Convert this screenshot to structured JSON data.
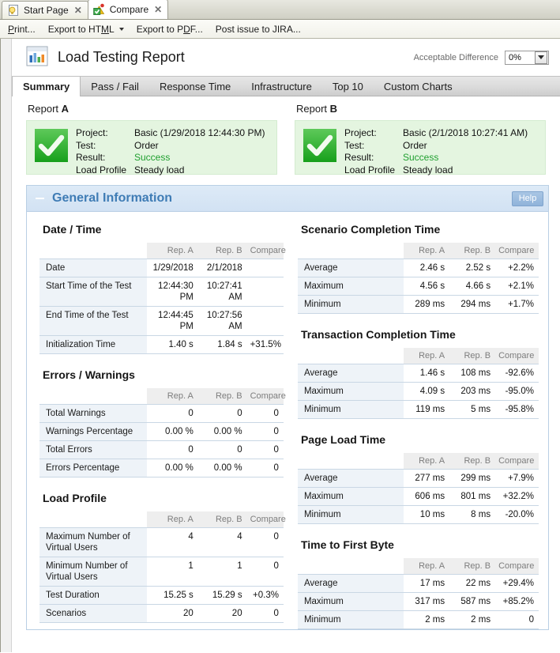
{
  "window": {
    "tabs": [
      {
        "label": "Start Page",
        "icon": "lightbulb-icon",
        "active": false,
        "close": "✕"
      },
      {
        "label": "Compare",
        "icon": "compare-icon",
        "active": true,
        "close": "✕"
      }
    ]
  },
  "command_bar": {
    "items": [
      {
        "label": "Print...",
        "name": "print-command",
        "mnemonic": "P",
        "split": false
      },
      {
        "label": "Export to HTML",
        "name": "export-html-command",
        "mnemonic": "M",
        "split": true
      },
      {
        "label": "Export to PDF...",
        "name": "export-pdf-command",
        "mnemonic": "D",
        "split": false
      },
      {
        "label": "Post issue to JIRA...",
        "name": "post-jira-command",
        "mnemonic": "",
        "split": false
      }
    ]
  },
  "report": {
    "title": "Load Testing Report",
    "acceptable_difference_label": "Acceptable Difference",
    "acceptable_difference_value": "0%"
  },
  "subtabs": [
    {
      "label": "Summary",
      "active": true
    },
    {
      "label": "Pass / Fail",
      "active": false
    },
    {
      "label": "Response Time",
      "active": false
    },
    {
      "label": "Infrastructure",
      "active": false
    },
    {
      "label": "Top 10",
      "active": false
    },
    {
      "label": "Custom Charts",
      "active": false
    }
  ],
  "cards": [
    {
      "caption_prefix": "Report ",
      "caption_letter": "A",
      "rows": [
        {
          "key": "Project:",
          "value": "Basic (1/29/2018 12:44:30 PM)",
          "state": ""
        },
        {
          "key": "Test:",
          "value": "Order",
          "state": ""
        },
        {
          "key": "Result:",
          "value": "Success",
          "state": "ok"
        },
        {
          "key": "Load Profile",
          "value": "Steady load",
          "state": ""
        }
      ]
    },
    {
      "caption_prefix": "Report ",
      "caption_letter": "B",
      "rows": [
        {
          "key": "Project:",
          "value": "Basic (2/1/2018 10:27:41 AM)",
          "state": ""
        },
        {
          "key": "Test:",
          "value": "Order",
          "state": ""
        },
        {
          "key": "Result:",
          "value": "Success",
          "state": "ok"
        },
        {
          "key": "Load Profile",
          "value": "Steady load",
          "state": ""
        }
      ]
    }
  ],
  "panel": {
    "title": "General Information",
    "help_label": "Help",
    "collapsed": false
  },
  "columns": {
    "headers": [
      "",
      "Rep. A",
      "Rep. B",
      "Compare"
    ],
    "left": [
      {
        "title": "Date / Time",
        "rows": [
          {
            "label": "Date",
            "a": "1/29/2018",
            "b": "2/1/2018",
            "compare": "",
            "compare_state": ""
          },
          {
            "label": "Start Time of the Test",
            "a": "12:44:30 PM",
            "b": "10:27:41 AM",
            "compare": "",
            "compare_state": ""
          },
          {
            "label": "End Time of the Test",
            "a": "12:44:45 PM",
            "b": "10:27:56 AM",
            "compare": "",
            "compare_state": ""
          },
          {
            "label": "Initialization Time",
            "a": "1.40 s",
            "b": "1.84 s",
            "compare": "+31.5%",
            "compare_state": "pos"
          }
        ]
      },
      {
        "title": "Errors / Warnings",
        "rows": [
          {
            "label": "Total Warnings",
            "a": "0",
            "b": "0",
            "compare": "0",
            "compare_state": "zero"
          },
          {
            "label": "Warnings Percentage",
            "a": "0.00 %",
            "b": "0.00 %",
            "compare": "0",
            "compare_state": "zero"
          },
          {
            "label": "Total Errors",
            "a": "0",
            "b": "0",
            "compare": "0",
            "compare_state": "zero"
          },
          {
            "label": "Errors Percentage",
            "a": "0.00 %",
            "b": "0.00 %",
            "compare": "0",
            "compare_state": "zero"
          }
        ]
      },
      {
        "title": "Load Profile",
        "rows": [
          {
            "label": "Maximum Number of Virtual Users",
            "a": "4",
            "b": "4",
            "compare": "0",
            "compare_state": "zero"
          },
          {
            "label": "Minimum Number of Virtual Users",
            "a": "1",
            "b": "1",
            "compare": "0",
            "compare_state": "zero"
          },
          {
            "label": "Test Duration",
            "a": "15.25 s",
            "b": "15.29 s",
            "compare": "+0.3%",
            "compare_state": "pos"
          },
          {
            "label": "Scenarios",
            "a": "20",
            "b": "20",
            "compare": "0",
            "compare_state": "zero"
          }
        ]
      }
    ],
    "right": [
      {
        "title": "Scenario Completion Time",
        "rows": [
          {
            "label": "Average",
            "a": "2.46 s",
            "b": "2.52 s",
            "compare": "+2.2%",
            "compare_state": "pos"
          },
          {
            "label": "Maximum",
            "a": "4.56 s",
            "b": "4.66 s",
            "compare": "+2.1%",
            "compare_state": "pos"
          },
          {
            "label": "Minimum",
            "a": "289 ms",
            "b": "294 ms",
            "compare": "+1.7%",
            "compare_state": "pos"
          }
        ]
      },
      {
        "title": "Transaction Completion Time",
        "rows": [
          {
            "label": "Average",
            "a": "1.46 s",
            "b": "108 ms",
            "compare": "-92.6%",
            "compare_state": "neg"
          },
          {
            "label": "Maximum",
            "a": "4.09 s",
            "b": "203 ms",
            "compare": "-95.0%",
            "compare_state": "neg"
          },
          {
            "label": "Minimum",
            "a": "119 ms",
            "b": "5 ms",
            "compare": "-95.8%",
            "compare_state": "neg"
          }
        ]
      },
      {
        "title": "Page Load Time",
        "rows": [
          {
            "label": "Average",
            "a": "277 ms",
            "b": "299 ms",
            "compare": "+7.9%",
            "compare_state": "pos"
          },
          {
            "label": "Maximum",
            "a": "606 ms",
            "b": "801 ms",
            "compare": "+32.2%",
            "compare_state": "pos"
          },
          {
            "label": "Minimum",
            "a": "10 ms",
            "b": "8 ms",
            "compare": "-20.0%",
            "compare_state": "neg"
          }
        ]
      },
      {
        "title": "Time to First Byte",
        "rows": [
          {
            "label": "Average",
            "a": "17 ms",
            "b": "22 ms",
            "compare": "+29.4%",
            "compare_state": "pos"
          },
          {
            "label": "Maximum",
            "a": "317 ms",
            "b": "587 ms",
            "compare": "+85.2%",
            "compare_state": "pos"
          },
          {
            "label": "Minimum",
            "a": "2 ms",
            "b": "2 ms",
            "compare": "0",
            "compare_state": "zero"
          }
        ]
      }
    ]
  },
  "colors": {
    "accent": "#3f7cb5",
    "positive_diff": "#d01414",
    "negative_diff": "#189a3c",
    "success": "#1f9f2f",
    "card_bg": "#e4f5e0"
  }
}
